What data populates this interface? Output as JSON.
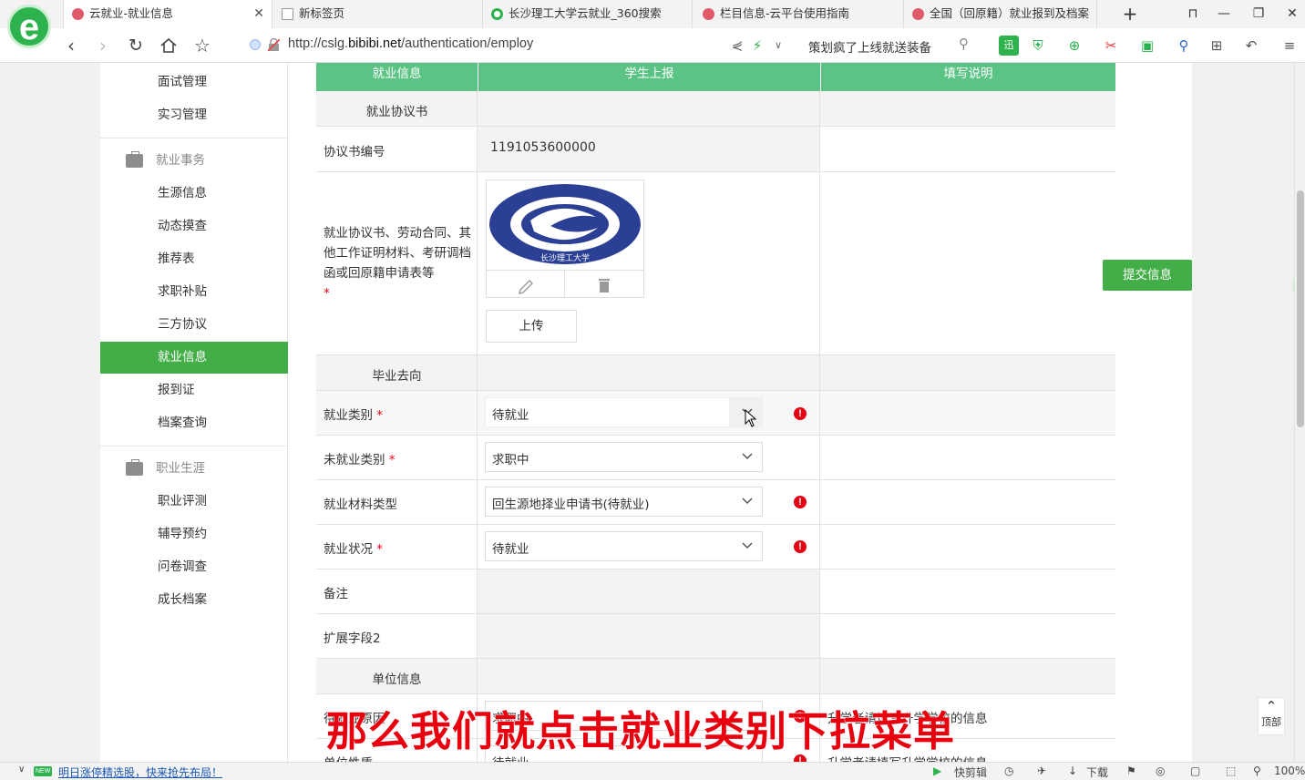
{
  "browser": {
    "logo_letter": "e",
    "tabs": [
      {
        "title": "云就业-就业信息",
        "active": true,
        "icon_color": "#e05a6a"
      },
      {
        "title": "新标签页",
        "active": false,
        "icon_color": "#888888"
      },
      {
        "title": "长沙理工大学云就业_360搜索",
        "active": false,
        "icon_color": "#2eb24e"
      },
      {
        "title": "栏目信息-云平台使用指南",
        "active": false,
        "icon_color": "#e05a6a"
      },
      {
        "title": "全国（回原籍）就业报到及档案",
        "active": false,
        "icon_color": "#e05a6a"
      }
    ],
    "url_prefix": "http://cslg.",
    "url_domain": "bibibi.net",
    "url_path": "/authentication/employ",
    "search_text": "策划疯了上线就送装备"
  },
  "sidebar": {
    "items_top": [
      "面试管理",
      "实习管理"
    ],
    "group1": "就业事务",
    "group1_items": [
      "生源信息",
      "动态摸查",
      "推荐表",
      "求职补贴",
      "三方协议",
      "就业信息",
      "报到证",
      "档案查询"
    ],
    "active_item": "就业信息",
    "group2": "职业生涯",
    "group2_items": [
      "职业评测",
      "辅导预约",
      "问卷调查",
      "成长档案"
    ]
  },
  "table": {
    "headers": [
      "就业信息",
      "学生上报",
      "填写说明"
    ],
    "section_agreement": "就业协议书",
    "agreement_no_label": "协议书编号",
    "agreement_no_value": "1191053600000",
    "materials_label": "就业协议书、劳动合同、其他工作证明材料、考研调档函或回原籍申请表等",
    "required_mark": "*",
    "upload_label": "上传",
    "section_destination": "毕业去向",
    "employment_type_label": "就业类别",
    "employment_type_value": "待就业",
    "unemployed_type_label": "未就业类别",
    "unemployed_type_value": "求职中",
    "material_type_label": "就业材料类型",
    "material_type_value": "回生源地择业申请书(待就业)",
    "employment_status_label": "就业状况",
    "employment_status_value": "待就业",
    "remark_label": "备注",
    "ext_field_label": "扩展字段2",
    "section_unit": "单位信息",
    "pending_reason_label": "待就业原因",
    "pending_reason_value": "求职中",
    "pending_reason_note": "升学者请填写升学学校的信息",
    "unit_nature_label": "单位性质",
    "unit_nature_value": "待就业",
    "unit_nature_note": "升学者请填写升学学校的信息",
    "warn_glyph": "!"
  },
  "submit_label": "提交信息",
  "to_top": {
    "arrow": "⌃",
    "label": "顶部"
  },
  "subtitle": "那么我们就点击就业类别下拉菜单",
  "statusbar": {
    "badge": "NEW",
    "news": "明日涨停精选股，快来抢先布局！",
    "quick_cut": "快剪辑",
    "download": "下载",
    "zoom": "100%"
  },
  "colors": {
    "green": "#43ae48",
    "header_green": "#5bc384",
    "required": "#e60012",
    "subtitle": "#e8000f"
  }
}
